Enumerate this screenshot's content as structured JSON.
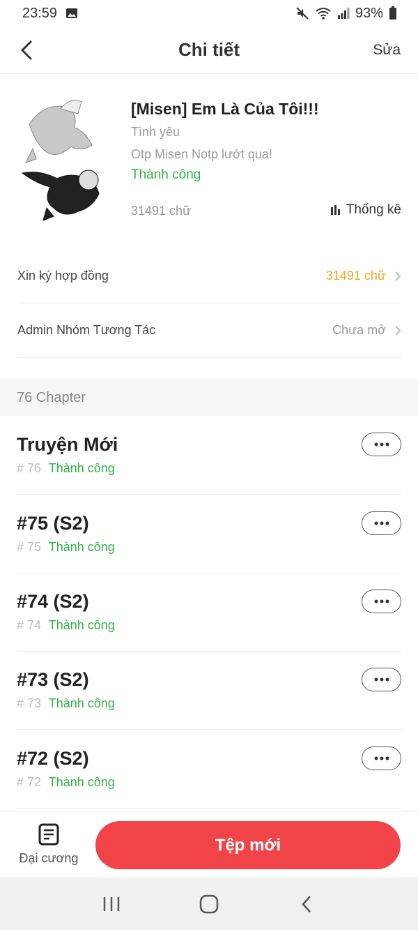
{
  "status_bar": {
    "time": "23:59",
    "battery": "93%"
  },
  "header": {
    "title": "Chi tiết",
    "edit_label": "Sửa"
  },
  "book": {
    "title": "[Misen] Em Là Của Tôi!!!",
    "genre": "Tình yêu",
    "description": "Otp Misen Notp lướt qua!",
    "status": "Thành công",
    "word_count": "31491 chữ",
    "stats_label": "Thống kê"
  },
  "rows": [
    {
      "label": "Xin ký hợp đồng",
      "value": "31491 chữ"
    },
    {
      "label": "Admin Nhóm Tương Tác",
      "value": "Chưa mở"
    }
  ],
  "chapter_section": {
    "count_label": "76 Chapter"
  },
  "chapters": [
    {
      "title": "Truyện Mới",
      "number": "# 76",
      "status": "Thành công"
    },
    {
      "title": "#75 (S2)",
      "number": "# 75",
      "status": "Thành công"
    },
    {
      "title": "#74 (S2)",
      "number": "# 74",
      "status": "Thành công"
    },
    {
      "title": "#73 (S2)",
      "number": "# 73",
      "status": "Thành công"
    },
    {
      "title": "#72 (S2)",
      "number": "# 72",
      "status": "Thành công"
    }
  ],
  "bottom": {
    "outline_label": "Đại cương",
    "new_file_label": "Tệp mới"
  },
  "colors": {
    "accent_red": "#f04448",
    "success_green": "#2fb344",
    "warning_orange": "#f5a623"
  }
}
